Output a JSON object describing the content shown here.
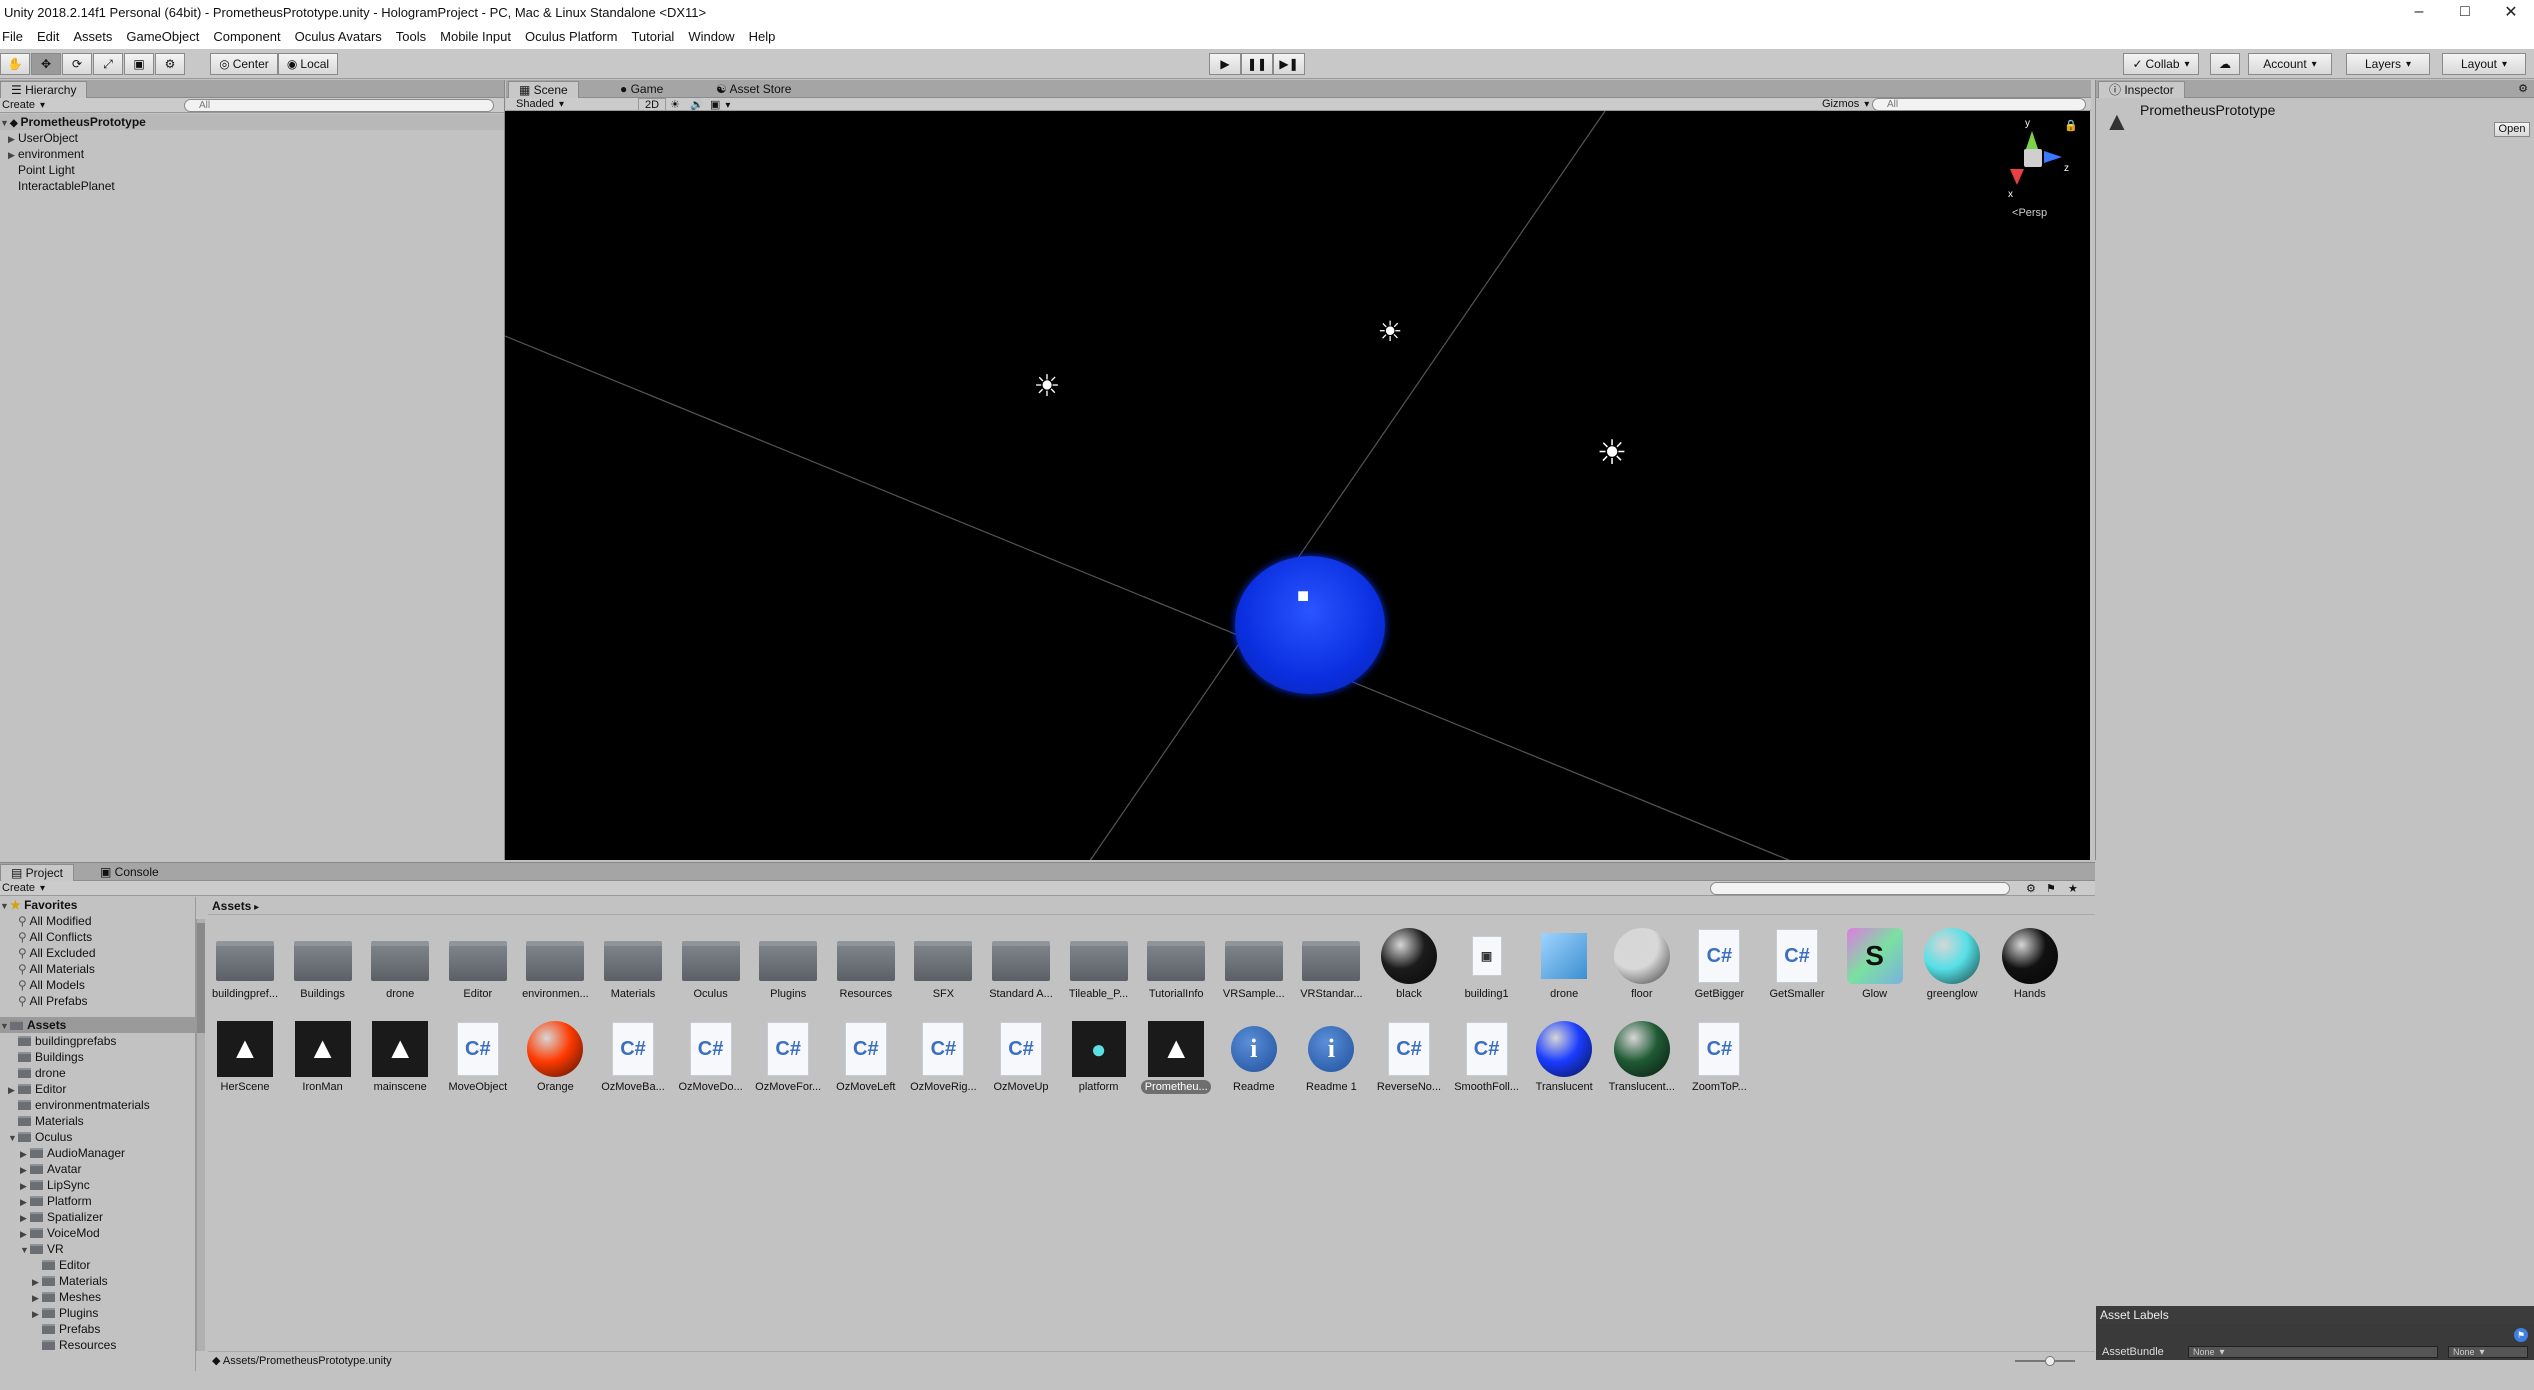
{
  "window": {
    "title": "Unity 2018.2.14f1 Personal (64bit) - PrometheusPrototype.unity - HologramProject - PC, Mac & Linux Standalone <DX11>"
  },
  "menu": [
    "File",
    "Edit",
    "Assets",
    "GameObject",
    "Component",
    "Oculus Avatars",
    "Tools",
    "Mobile Input",
    "Oculus Platform",
    "Tutorial",
    "Window",
    "Help"
  ],
  "toolbar": {
    "center": "Center",
    "local": "Local",
    "collab": "Collab",
    "account": "Account",
    "layers": "Layers",
    "layout": "Layout"
  },
  "hierarchy": {
    "tab": "Hierarchy",
    "create": "Create",
    "search_placeholder": "All",
    "scene": "PrometheusPrototype",
    "items": [
      "UserObject",
      "environment",
      "Point Light",
      "InteractablePlanet"
    ]
  },
  "scene_view": {
    "tabs": [
      "Scene",
      "Game",
      "Asset Store"
    ],
    "shading": "Shaded",
    "mode2d": "2D",
    "gizmos": "Gizmos",
    "search_placeholder": "All",
    "persp": "Persp",
    "axis_y": "y",
    "axis_z": "z",
    "axis_x": "x"
  },
  "inspector": {
    "tab": "Inspector",
    "object": "PrometheusPrototype",
    "open": "Open",
    "asset_labels": "Asset Labels",
    "assetbundle": "AssetBundle",
    "none1": "None",
    "none2": "None"
  },
  "project": {
    "tabs": [
      "Project",
      "Console"
    ],
    "create": "Create",
    "breadcrumb": "Assets",
    "path": "Assets/PrometheusPrototype.unity",
    "favorites_title": "Favorites",
    "favorites": [
      "All Modified",
      "All Conflicts",
      "All Excluded",
      "All Materials",
      "All Models",
      "All Prefabs"
    ],
    "assets_root": "Assets",
    "tree": [
      "buildingprefabs",
      "Buildings",
      "drone",
      "Editor",
      "environmentmaterials",
      "Materials",
      "Oculus",
      "AudioManager",
      "Avatar",
      "LipSync",
      "Platform",
      "Spatializer",
      "VoiceMod",
      "VR",
      "Editor",
      "Materials",
      "Meshes",
      "Plugins",
      "Prefabs",
      "Resources"
    ],
    "assets_row1": [
      {
        "label": "buildingpref...",
        "kind": "folder"
      },
      {
        "label": "Buildings",
        "kind": "folder"
      },
      {
        "label": "drone",
        "kind": "folder"
      },
      {
        "label": "Editor",
        "kind": "folder"
      },
      {
        "label": "environmen...",
        "kind": "folder"
      },
      {
        "label": "Materials",
        "kind": "folder"
      },
      {
        "label": "Oculus",
        "kind": "folder"
      },
      {
        "label": "Plugins",
        "kind": "folder"
      },
      {
        "label": "Resources",
        "kind": "folder"
      },
      {
        "label": "SFX",
        "kind": "folder"
      },
      {
        "label": "Standard A...",
        "kind": "folder"
      },
      {
        "label": "Tileable_P...",
        "kind": "folder"
      },
      {
        "label": "TutorialInfo",
        "kind": "folder"
      },
      {
        "label": "VRSample...",
        "kind": "folder"
      },
      {
        "label": "VRStandar...",
        "kind": "folder"
      },
      {
        "label": "black",
        "kind": "sphere",
        "color": "#1c1c1c"
      },
      {
        "label": "building1",
        "kind": "fbx"
      },
      {
        "label": "drone",
        "kind": "cube"
      },
      {
        "label": "floor",
        "kind": "sphere",
        "color": "#d8d8d8"
      },
      {
        "label": "GetBigger",
        "kind": "cs"
      },
      {
        "label": "GetSmaller",
        "kind": "cs"
      },
      {
        "label": "Glow",
        "kind": "shader"
      },
      {
        "label": "greenglow",
        "kind": "sphere",
        "color": "#56e0e6"
      },
      {
        "label": "Hands",
        "kind": "sphere",
        "color": "#111111"
      }
    ],
    "assets_row2": [
      {
        "label": "HerScene",
        "kind": "unity"
      },
      {
        "label": "IronMan",
        "kind": "unity"
      },
      {
        "label": "mainscene",
        "kind": "unity"
      },
      {
        "label": "MoveObject",
        "kind": "cs"
      },
      {
        "label": "Orange",
        "kind": "sphere",
        "color": "#ff3a00"
      },
      {
        "label": "OzMoveBa...",
        "kind": "cs"
      },
      {
        "label": "OzMoveDo...",
        "kind": "cs"
      },
      {
        "label": "OzMoveFor...",
        "kind": "cs"
      },
      {
        "label": "OzMoveLeft",
        "kind": "cs"
      },
      {
        "label": "OzMoveRig...",
        "kind": "cs"
      },
      {
        "label": "OzMoveUp",
        "kind": "cs"
      },
      {
        "label": "platform",
        "kind": "platform"
      },
      {
        "label": "Prometheu...",
        "kind": "unity",
        "selected": true
      },
      {
        "label": "Readme",
        "kind": "info"
      },
      {
        "label": "Readme 1",
        "kind": "info"
      },
      {
        "label": "ReverseNo...",
        "kind": "cs"
      },
      {
        "label": "SmoothFoll...",
        "kind": "cs"
      },
      {
        "label": "Translucent",
        "kind": "sphere",
        "color": "#1a3cff"
      },
      {
        "label": "Translucent...",
        "kind": "sphere",
        "color": "#1f5a34"
      },
      {
        "label": "ZoomToP...",
        "kind": "cs"
      }
    ]
  }
}
